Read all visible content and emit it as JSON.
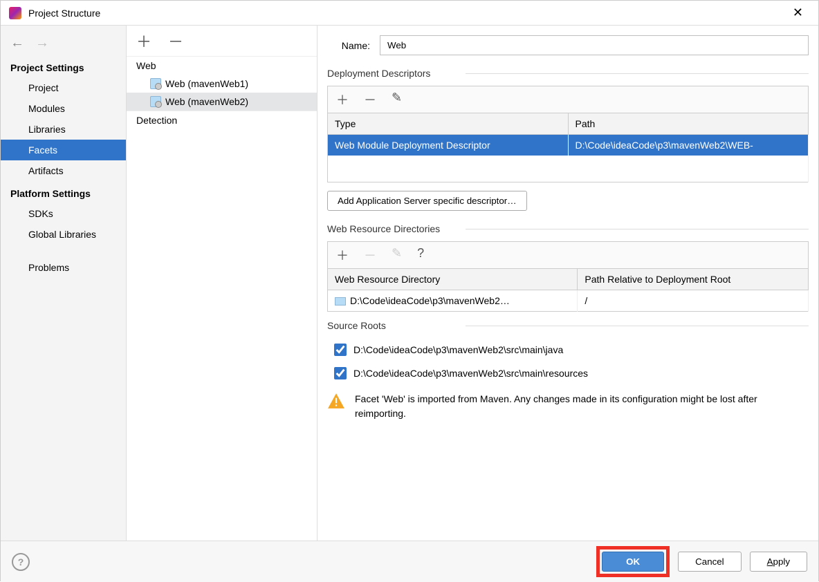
{
  "window": {
    "title": "Project Structure"
  },
  "sidebar": {
    "section1": "Project Settings",
    "items1": [
      "Project",
      "Modules",
      "Libraries",
      "Facets",
      "Artifacts"
    ],
    "section2": "Platform Settings",
    "items2": [
      "SDKs",
      "Global Libraries"
    ],
    "section3": "Problems"
  },
  "tree": {
    "root": "Web",
    "children": [
      "Web (mavenWeb1)",
      "Web (mavenWeb2)"
    ],
    "detection": "Detection"
  },
  "form": {
    "name_label": "Name:",
    "name_value": "Web"
  },
  "deploy": {
    "heading": "Deployment Descriptors",
    "col_type": "Type",
    "col_path": "Path",
    "row_type": "Web Module Deployment Descriptor",
    "row_path": "D:\\Code\\ideaCode\\p3\\mavenWeb2\\WEB-",
    "add_btn": "Add Application Server specific descriptor…"
  },
  "webres": {
    "heading": "Web Resource Directories",
    "col_dir": "Web Resource Directory",
    "col_path": "Path Relative to Deployment Root",
    "row_dir": "D:\\Code\\ideaCode\\p3\\mavenWeb2…",
    "row_path": "/"
  },
  "roots": {
    "heading": "Source Roots",
    "items": [
      "D:\\Code\\ideaCode\\p3\\mavenWeb2\\src\\main\\java",
      "D:\\Code\\ideaCode\\p3\\mavenWeb2\\src\\main\\resources"
    ]
  },
  "warning": "Facet 'Web' is imported from Maven. Any changes made in its configuration might be lost after reimporting.",
  "buttons": {
    "ok": "OK",
    "cancel": "Cancel",
    "apply": "Apply"
  }
}
